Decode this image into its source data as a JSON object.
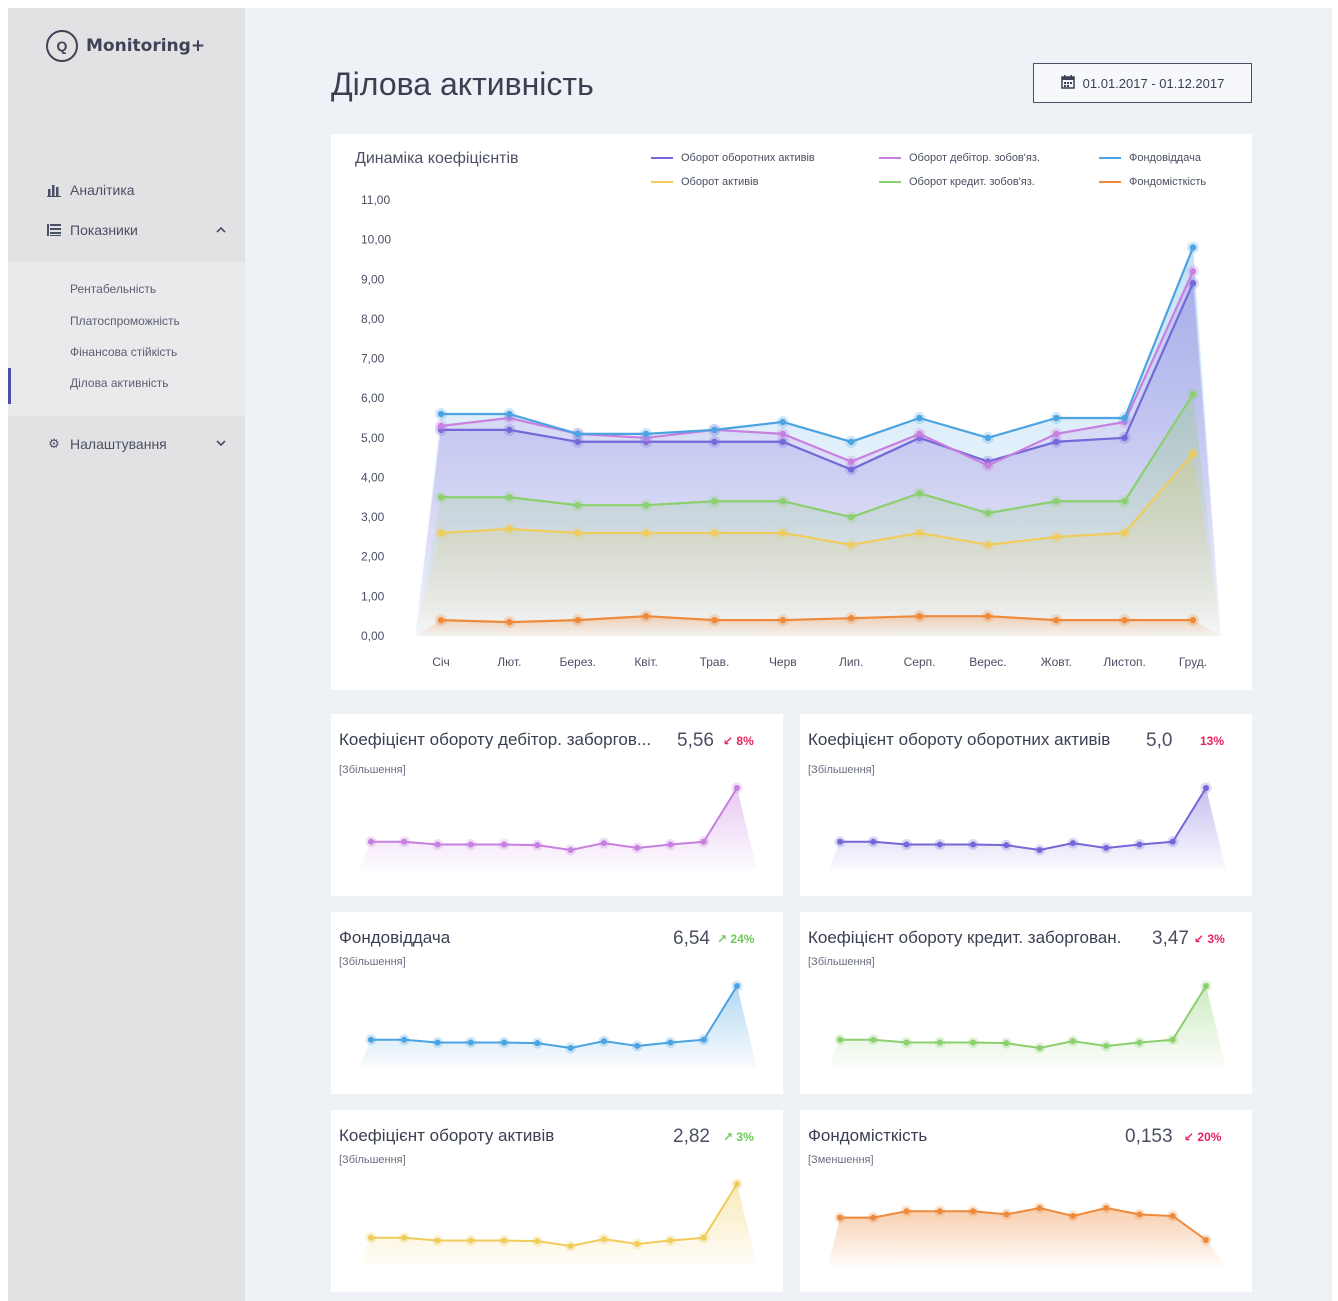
{
  "sidebar": {
    "logo_mark": "Q",
    "logo_text": "Monitoring+",
    "nav": [
      {
        "label": "Аналітика",
        "icon": "bar-chart-icon"
      },
      {
        "label": "Показники",
        "icon": "list-icon",
        "chevron": "^"
      },
      {
        "label": "Налаштування",
        "icon": "gear-icon",
        "chevron": "v"
      }
    ],
    "submenu": [
      "Рентабельність",
      "Платоспроможність",
      "Фінансова стійкість",
      "Ділова активність"
    ]
  },
  "header": {
    "title": "Ділова активність",
    "date_range": "01.01.2017 - 01.12.2017"
  },
  "chart_data": [
    {
      "type": "line",
      "title": "Динаміка коефіцієнтів",
      "categories": [
        "Січ",
        "Лют.",
        "Берез.",
        "Квіт.",
        "Трав.",
        "Черв",
        "Лип.",
        "Серп.",
        "Верес.",
        "Жовт.",
        "Листоп.",
        "Груд."
      ],
      "ylim": [
        0,
        11
      ],
      "yticks": [
        "0,00",
        "1,00",
        "2,00",
        "3,00",
        "4,00",
        "5,00",
        "6,00",
        "7,00",
        "8,00",
        "9,00",
        "10,00",
        "11,00"
      ],
      "legend_position": "top-right",
      "series": [
        {
          "name": "Оборот оборотних активів",
          "color": "#7468d9",
          "values": [
            5.2,
            5.2,
            4.9,
            4.9,
            4.9,
            4.9,
            4.2,
            5.0,
            4.4,
            4.9,
            5.0,
            8.9
          ]
        },
        {
          "name": "Оборот дебітор. зобов'яз.",
          "color": "#c77fe0",
          "values": [
            5.3,
            5.5,
            5.1,
            5.0,
            5.2,
            5.1,
            4.4,
            5.1,
            4.3,
            5.1,
            5.4,
            9.2
          ]
        },
        {
          "name": "Фондовіддача",
          "color": "#4ba3e2",
          "values": [
            5.6,
            5.6,
            5.1,
            5.1,
            5.2,
            5.4,
            4.9,
            5.5,
            5.0,
            5.5,
            5.5,
            9.8
          ]
        },
        {
          "name": "Оборот активів",
          "color": "#f0cc5a",
          "values": [
            2.6,
            2.7,
            2.6,
            2.6,
            2.6,
            2.6,
            2.3,
            2.6,
            2.3,
            2.5,
            2.6,
            4.6
          ]
        },
        {
          "name": "Оборот кредит. зобов'яз.",
          "color": "#8bcf6e",
          "values": [
            3.5,
            3.5,
            3.3,
            3.3,
            3.4,
            3.4,
            3.0,
            3.6,
            3.1,
            3.4,
            3.4,
            6.1
          ]
        },
        {
          "name": "Фондомісткість",
          "color": "#ee8a3c",
          "values": [
            0.4,
            0.35,
            0.4,
            0.5,
            0.4,
            0.4,
            0.45,
            0.5,
            0.5,
            0.4,
            0.4,
            0.4
          ]
        }
      ]
    },
    {
      "type": "area",
      "title": "Коефіцієнт обороту дебітор. заборгов...",
      "color": "#c77fe0",
      "values": [
        5.3,
        5.3,
        5.1,
        5.1,
        5.1,
        5.05,
        4.7,
        5.2,
        4.85,
        5.1,
        5.3,
        9.2
      ]
    },
    {
      "type": "area",
      "title": "Коефіцієнт обороту оборотних активів",
      "color": "#7468d9",
      "values": [
        5.3,
        5.3,
        5.1,
        5.1,
        5.1,
        5.05,
        4.7,
        5.2,
        4.85,
        5.1,
        5.3,
        9.2
      ]
    },
    {
      "type": "area",
      "title": "Фондовіддача",
      "color": "#4ba3e2",
      "values": [
        5.3,
        5.3,
        5.1,
        5.1,
        5.1,
        5.05,
        4.7,
        5.2,
        4.85,
        5.1,
        5.3,
        9.2
      ]
    },
    {
      "type": "area",
      "title": "Коефіцієнт обороту кредит. заборгован.",
      "color": "#8bcf6e",
      "values": [
        5.3,
        5.3,
        5.1,
        5.1,
        5.1,
        5.05,
        4.7,
        5.2,
        4.85,
        5.1,
        5.3,
        9.2
      ]
    },
    {
      "type": "area",
      "title": "Коефіцієнт обороту активів",
      "color": "#f0cc5a",
      "values": [
        5.3,
        5.3,
        5.1,
        5.1,
        5.1,
        5.05,
        4.7,
        5.2,
        4.85,
        5.1,
        5.3,
        9.2
      ]
    },
    {
      "type": "area",
      "title": "Фондомісткість",
      "color": "#ee8a3c",
      "values": [
        0.15,
        0.15,
        0.154,
        0.154,
        0.154,
        0.152,
        0.156,
        0.151,
        0.156,
        0.152,
        0.151,
        0.136
      ]
    }
  ],
  "cards": [
    {
      "title": "Коефіцієнт обороту дебітор. заборгов...",
      "value": "5,56",
      "arrow": "↙",
      "pct": "8%",
      "trend": "down",
      "sub": "[Збільшення]"
    },
    {
      "title": "Коефіцієнт обороту оборотних активів",
      "value": "5,0",
      "arrow": "",
      "pct": "13%",
      "trend": "down",
      "sub": "[Збільшення]"
    },
    {
      "title": "Фондовіддача",
      "value": "6,54",
      "arrow": "↗",
      "pct": "24%",
      "trend": "up",
      "sub": "[Збільшення]"
    },
    {
      "title": "Коефіцієнт обороту кредит. заборгован.",
      "value": "3,47",
      "arrow": "↙",
      "pct": "3%",
      "trend": "down",
      "sub": "[Збільшення]"
    },
    {
      "title": "Коефіцієнт обороту активів",
      "value": "2,82",
      "arrow": "↗",
      "pct": "3%",
      "trend": "up",
      "sub": "[Збільшення]"
    },
    {
      "title": "Фондомісткість",
      "value": "0,153",
      "arrow": "↙",
      "pct": "20%",
      "trend": "down",
      "sub": "[Зменшення]"
    }
  ],
  "colors": {
    "up": "#6ecb5a",
    "down": "#e5245d",
    "accent": "#4b4fa8"
  }
}
